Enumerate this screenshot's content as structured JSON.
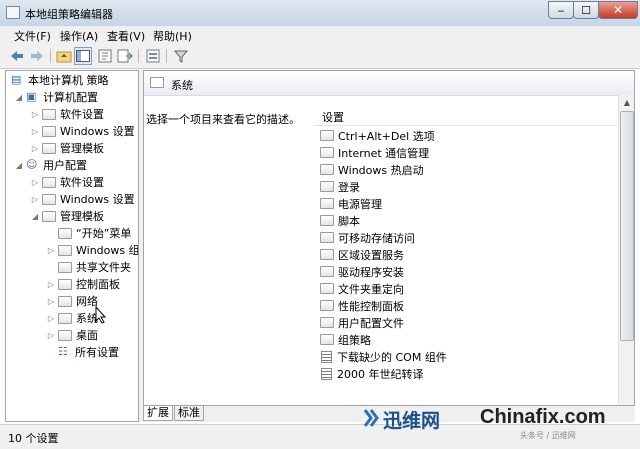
{
  "window": {
    "title": "本地组策略编辑器",
    "close_glyph": "✕",
    "min_glyph": "‒",
    "max_glyph": "☐"
  },
  "menu": [
    "文件(F)",
    "操作(A)",
    "查看(V)",
    "帮助(H)"
  ],
  "toolbar": {
    "icons": [
      "back-arrow-icon",
      "forward-arrow-icon",
      "up-folder-icon",
      "show-hide-tree-icon",
      "refresh-icon",
      "export-list-icon",
      "properties-icon",
      "filter-icon"
    ]
  },
  "tree": {
    "root": "本地计算机 策略",
    "computer_config": "计算机配置",
    "cc_software": "软件设置",
    "cc_windows": "Windows 设置",
    "cc_admin": "管理模板",
    "user_config": "用户配置",
    "uc_software": "软件设置",
    "uc_windows": "Windows 设置",
    "uc_admin": "管理模板",
    "start_menu": "“开始”菜单",
    "windows_comp": "Windows 组件",
    "shared_folders": "共享文件夹",
    "control_panel": "控制面板",
    "network": "网络",
    "system": "系统",
    "desktop": "桌面",
    "all_settings": "所有设置"
  },
  "right_pane": {
    "header_title": "系统",
    "description": "选择一个项目来查看它的描述。",
    "column_header": "设置",
    "items": [
      "Ctrl+Alt+Del 选项",
      "Internet 通信管理",
      "Windows 热启动",
      "登录",
      "电源管理",
      "脚本",
      "可移动存储访问",
      "区域设置服务",
      "驱动程序安装",
      "文件夹重定向",
      "性能控制面板",
      "用户配置文件",
      "组策略",
      "下载缺少的 COM 组件",
      "2000 年世纪转译"
    ]
  },
  "tabs": [
    "扩展",
    "标准"
  ],
  "status": "10 个设置",
  "watermark": {
    "brand_cn": "迅维网",
    "brand_en": "Chinafix.com",
    "sub": "头条号 / 迅维网"
  },
  "colors": {
    "accent": "#3a6ea5",
    "watermark_blue": "#1b4f8f",
    "watermark_logo": "#2a6cc4"
  }
}
